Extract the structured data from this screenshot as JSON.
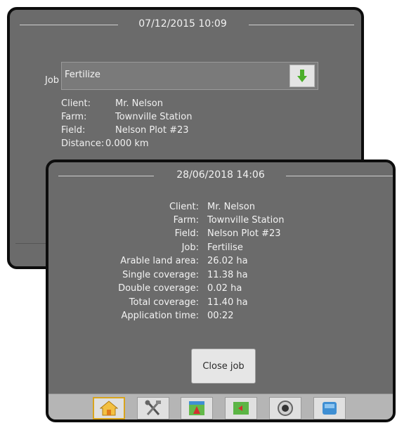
{
  "back_screen": {
    "header_datetime": "07/12/2015 10:09",
    "job_label": "Job",
    "job_value": "Fertilize",
    "info": [
      {
        "label": "Client:",
        "value": "Mr. Nelson"
      },
      {
        "label": "Farm:",
        "value": "Townville Station"
      },
      {
        "label": "Field:",
        "value": "Nelson Plot #23"
      },
      {
        "label": "Distance:",
        "value": "0.000 km"
      }
    ],
    "download_icon": "green-down-arrow-icon"
  },
  "front_screen": {
    "header_datetime": "28/06/2018 14:06",
    "summary": [
      {
        "label": "Client:",
        "value": "Mr. Nelson"
      },
      {
        "label": "Farm:",
        "value": "Townville Station"
      },
      {
        "label": "Field:",
        "value": "Nelson Plot #23"
      },
      {
        "label": "Job:",
        "value": "Fertilise"
      },
      {
        "label": "Arable land area:",
        "value": "26.02 ha"
      },
      {
        "label": "Single coverage:",
        "value": "11.38 ha"
      },
      {
        "label": "Double coverage:",
        "value": "0.02 ha"
      },
      {
        "label": "Total coverage:",
        "value": "11.40 ha"
      },
      {
        "label": "Application time:",
        "value": "00:22"
      }
    ],
    "close_button_label": "Close job"
  },
  "toolbar": {
    "buttons": [
      {
        "name": "home",
        "icon": "home-icon",
        "active": true
      },
      {
        "name": "tools",
        "icon": "tools-icon",
        "active": false
      },
      {
        "name": "vehicle-view",
        "icon": "vehicle-view-icon",
        "active": false
      },
      {
        "name": "field-view",
        "icon": "field-view-icon",
        "active": false
      },
      {
        "name": "gnss",
        "icon": "gnss-status-icon",
        "active": false
      },
      {
        "name": "data",
        "icon": "data-icon",
        "active": false
      }
    ]
  },
  "colors": {
    "panel_bg": "#6b6b6b",
    "active_tab_border": "#d8a41e",
    "download_arrow": "#4caf2a"
  }
}
